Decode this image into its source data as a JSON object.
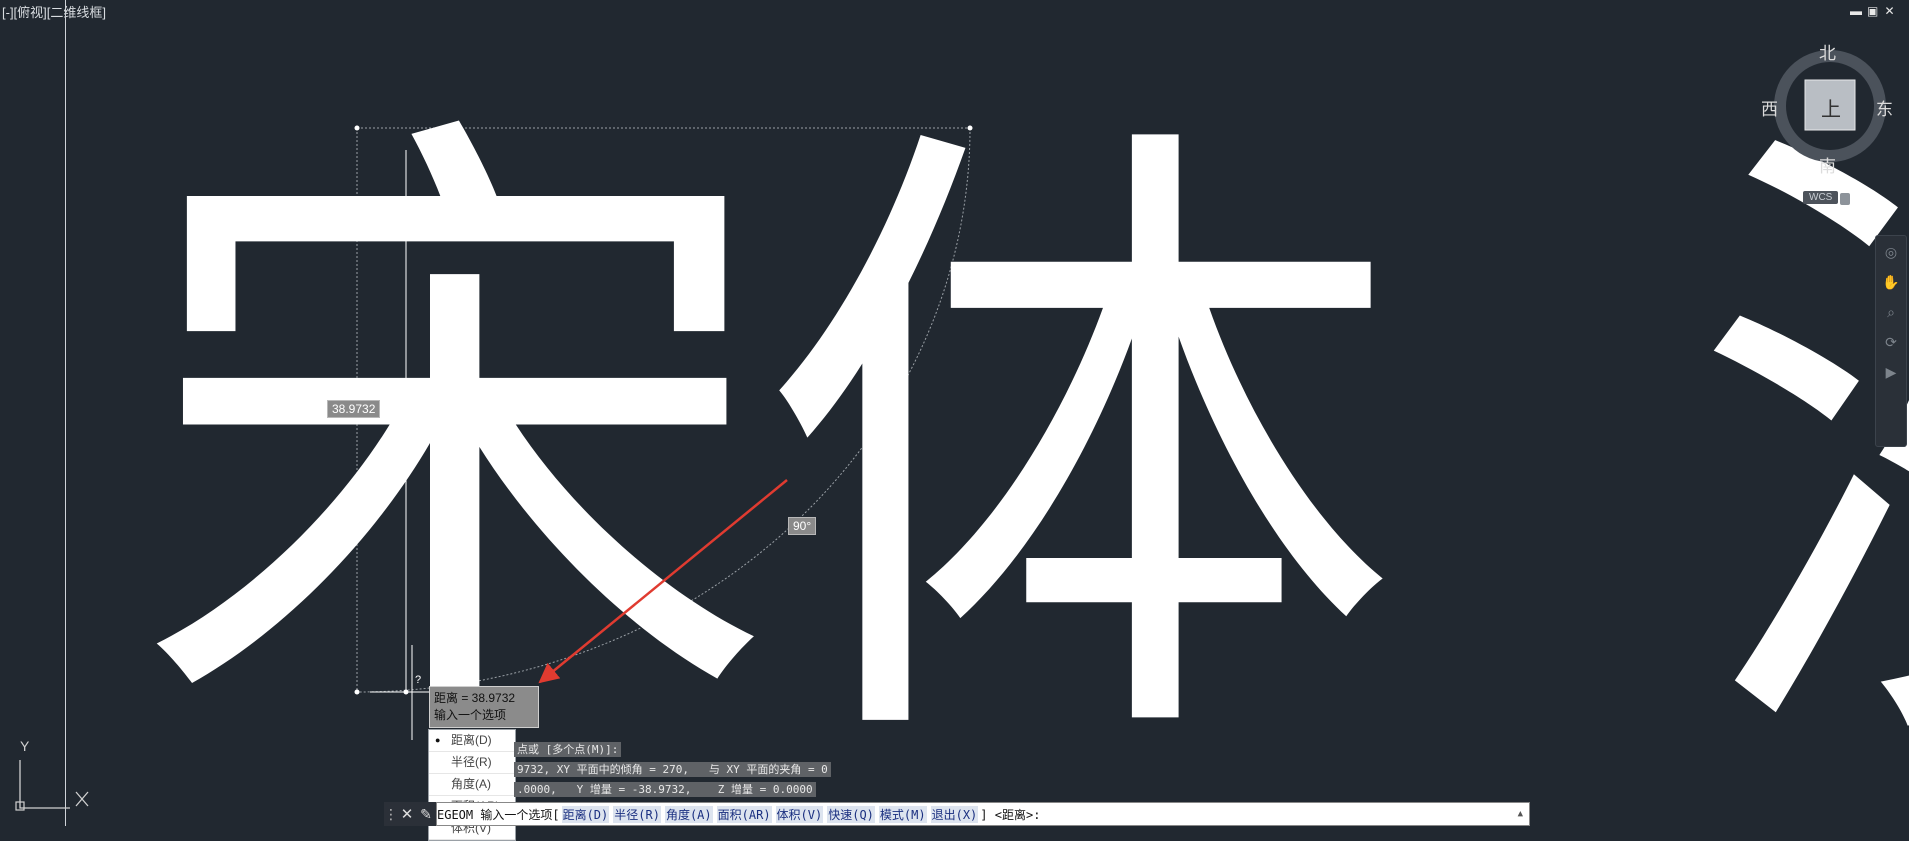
{
  "viewport": {
    "label": "[-][俯视][二维线框]"
  },
  "window_controls": {
    "minimize": "▬",
    "restore": "▣",
    "close": "✕"
  },
  "text_objects": {
    "char1": "宋",
    "char2": "体",
    "char3": "沙"
  },
  "dimensions": {
    "distance_label": "38.9732",
    "angle_label": "90°"
  },
  "tooltip": {
    "line1": "距离 = 38.9732",
    "line2": "输入一个选项",
    "question_mark": "?"
  },
  "option_menu": {
    "items": [
      {
        "label": "距离(D)",
        "selected": true
      },
      {
        "label": "半径(R)",
        "selected": false
      },
      {
        "label": "角度(A)",
        "selected": false
      },
      {
        "label": "面积(AR)",
        "selected": false
      },
      {
        "label": "体积(V)",
        "selected": false
      }
    ]
  },
  "history": {
    "line1": "点或 [多个点(M)]:",
    "line2": "9732, XY 平面中的倾角 = 270,   与 XY 平面的夹角 = 0",
    "line3": ".0000,   Y 增量 = -38.9732,    Z 增量 = 0.0000"
  },
  "command_line": {
    "prefix": "EGEOM 输入一个选项[",
    "options": [
      "距离(D)",
      "半径(R)",
      "角度(A)",
      "面积(AR)",
      "体积(V)",
      "快速(Q)",
      "模式(M)",
      "退出(X)"
    ],
    "suffix": "] <距离>:"
  },
  "viewcube": {
    "north": "北",
    "south": "南",
    "east": "东",
    "west": "西",
    "face": "上",
    "wcs": "WCS"
  },
  "ucs": {
    "y_label": "Y"
  },
  "colors": {
    "background": "#212830",
    "measure_arrow": "#e03b30",
    "text_fill": "#ffffff"
  }
}
